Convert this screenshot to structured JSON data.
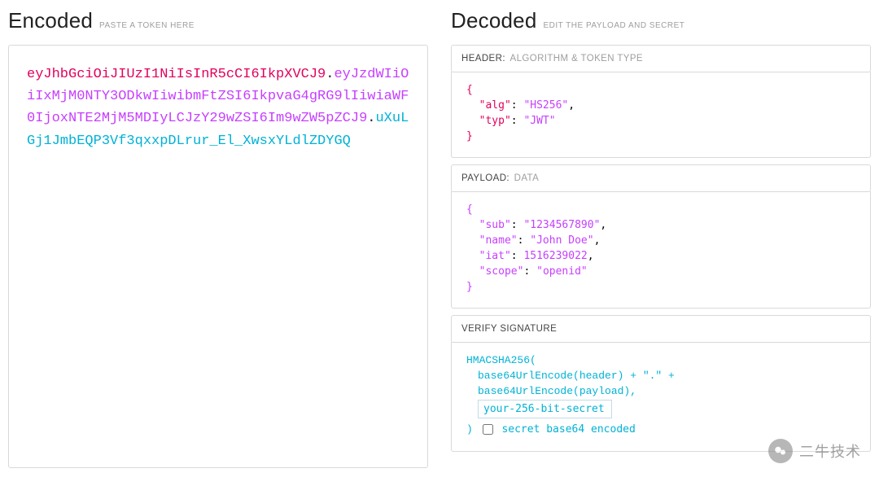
{
  "encoded": {
    "title": "Encoded",
    "subtitle": "PASTE A TOKEN HERE",
    "jwt": {
      "header": "eyJhbGciOiJIUzI1NiIsInR5cCI6IkpXVCJ9",
      "payload": "eyJzdWIiOiIxMjM0NTY3ODkwIiwibmFtZSI6IkpvaG4gRG9lIiwiaWF0IjoxNTE2MjM5MDIyLCJzY29wZSI6Im9wZW5pZCJ9",
      "signature": "uXuLGj1JmbEQP3Vf3qxxpDLrur_El_XwsxYLdlZDYGQ"
    }
  },
  "decoded": {
    "title": "Decoded",
    "subtitle": "EDIT THE PAYLOAD AND SECRET",
    "headerSection": {
      "label": "HEADER:",
      "sublabel": "ALGORITHM & TOKEN TYPE",
      "json": {
        "alg": "HS256",
        "typ": "JWT"
      }
    },
    "payloadSection": {
      "label": "PAYLOAD:",
      "sublabel": "DATA",
      "json": {
        "sub": "1234567890",
        "name": "John Doe",
        "iat": 1516239022,
        "scope": "openid"
      }
    },
    "signatureSection": {
      "label": "VERIFY SIGNATURE",
      "algFn": "HMACSHA256(",
      "line1": "base64UrlEncode(header) + \".\" +",
      "line2": "base64UrlEncode(payload),",
      "secretPlaceholder": "your-256-bit-secret",
      "secretValue": "your-256-bit-secret",
      "closeParen": ")",
      "checkboxLabel": "secret base64 encoded"
    }
  },
  "watermark": "二牛技术"
}
